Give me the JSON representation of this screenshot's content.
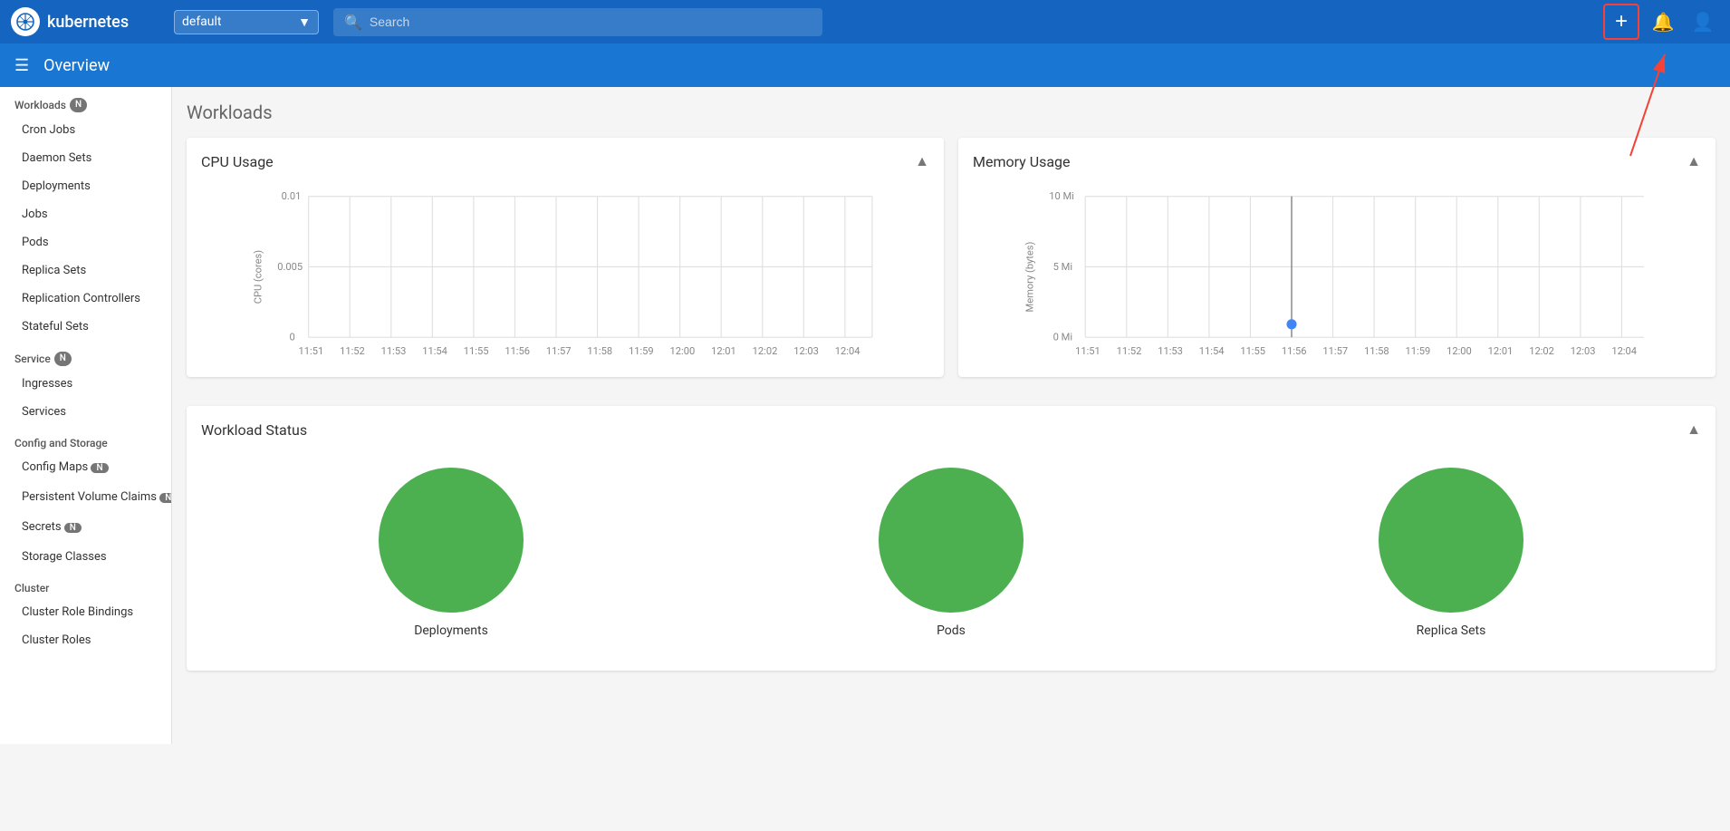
{
  "topNav": {
    "logoText": "kubernetes",
    "namespace": "default",
    "searchPlaceholder": "Search",
    "addButtonLabel": "+",
    "icons": {
      "bell": "🔔",
      "user": "👤"
    }
  },
  "subHeader": {
    "title": "Overview"
  },
  "sidebar": {
    "workloads": {
      "title": "Workloads",
      "badge": "N",
      "items": [
        "Cron Jobs",
        "Daemon Sets",
        "Deployments",
        "Jobs",
        "Pods",
        "Replica Sets",
        "Replication Controllers",
        "Stateful Sets"
      ]
    },
    "service": {
      "title": "Service",
      "badge": "N",
      "items": [
        "Ingresses",
        "Services"
      ]
    },
    "configStorage": {
      "title": "Config and Storage",
      "items": [
        "Config Maps",
        "Persistent Volume Claims",
        "Secrets",
        "Storage Classes"
      ],
      "badges": {
        "Config Maps": "N",
        "Persistent Volume Claims": "N",
        "Secrets": "N"
      }
    },
    "cluster": {
      "title": "Cluster",
      "items": [
        "Cluster Role Bindings",
        "Cluster Roles"
      ]
    }
  },
  "main": {
    "workloadsTitle": "Workloads",
    "cpuChart": {
      "title": "CPU Usage",
      "yLabel": "CPU (cores)",
      "yValues": [
        "0.01",
        "0.005",
        "0"
      ],
      "xLabels": [
        "11:51",
        "11:52",
        "11:53",
        "11:54",
        "11:55",
        "11:56",
        "11:57",
        "11:58",
        "11:59",
        "12:00",
        "12:01",
        "12:02",
        "12:03",
        "12:04"
      ]
    },
    "memoryChart": {
      "title": "Memory Usage",
      "yLabel": "Memory (bytes)",
      "yValues": [
        "10 Mi",
        "5 Mi",
        "0 Mi"
      ],
      "xLabels": [
        "11:51",
        "11:52",
        "11:53",
        "11:54",
        "11:55",
        "11:56",
        "11:57",
        "11:58",
        "11:59",
        "12:00",
        "12:01",
        "12:02",
        "12:03",
        "12:04"
      ],
      "dataPointX": "11:56"
    },
    "workloadStatus": {
      "title": "Workload Status",
      "items": [
        {
          "label": "Deployments",
          "color": "#4caf50"
        },
        {
          "label": "Pods",
          "color": "#4caf50"
        },
        {
          "label": "Replica Sets",
          "color": "#4caf50"
        }
      ]
    }
  }
}
